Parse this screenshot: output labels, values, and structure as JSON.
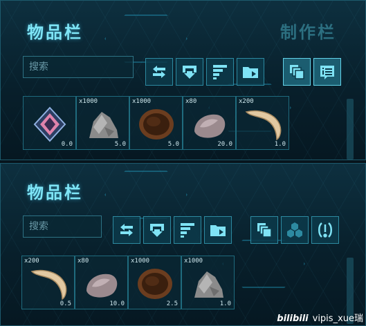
{
  "top": {
    "title": "物品栏",
    "craft_tab": "制作栏",
    "search_placeholder": "搜索",
    "slots": [
      {
        "qty": "",
        "weight": "0.0",
        "item": "crystal-icon"
      },
      {
        "qty": "x1000",
        "weight": "5.0",
        "item": "stone-icon"
      },
      {
        "qty": "x1000",
        "weight": "5.0",
        "item": "hide-icon"
      },
      {
        "qty": "x80",
        "weight": "20.0",
        "item": "flint-icon"
      },
      {
        "qty": "x200",
        "weight": "1.0",
        "item": "horn-icon"
      }
    ]
  },
  "bottom": {
    "title": "物品栏",
    "search_placeholder": "搜索",
    "slots": [
      {
        "qty": "x200",
        "weight": "0.5",
        "item": "horn-icon"
      },
      {
        "qty": "x80",
        "weight": "10.0",
        "item": "flint-icon"
      },
      {
        "qty": "x1000",
        "weight": "2.5",
        "item": "hide-icon"
      },
      {
        "qty": "x1000",
        "weight": "1.0",
        "item": "stone-icon"
      }
    ]
  },
  "watermark": {
    "logo": "bilibili",
    "user": "vipis_xue瑞"
  },
  "colors": {
    "accent": "#7fe6f7",
    "border": "#2d8aa1",
    "panel": "#0b2a38"
  }
}
